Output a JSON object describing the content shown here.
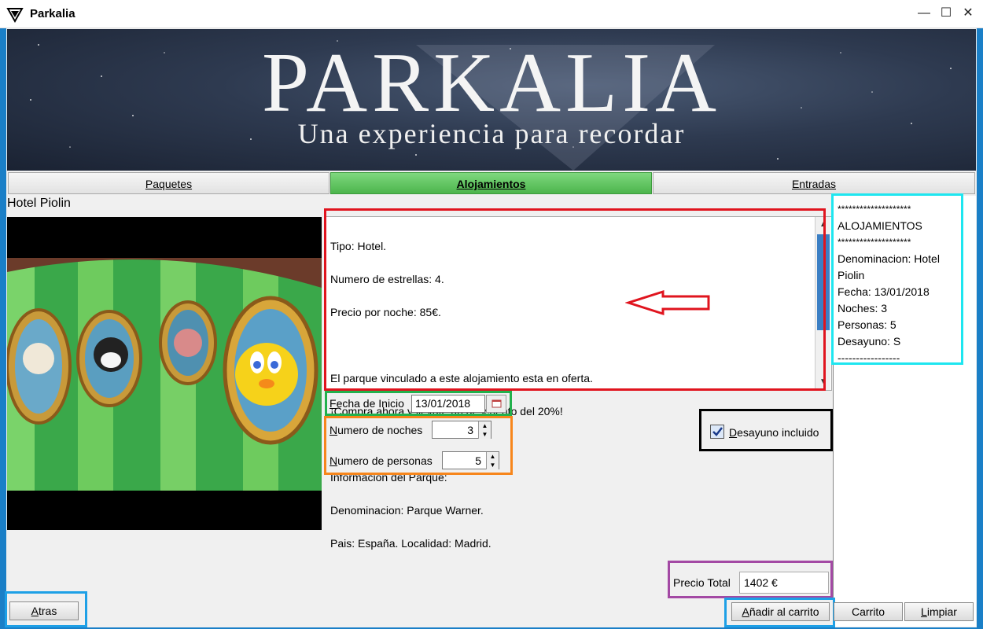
{
  "window": {
    "title": "Parkalia",
    "minimize": "—",
    "maximize": "☐",
    "close": "✕"
  },
  "banner": {
    "title": "PARKALIA",
    "subtitle": "Una experiencia para recordar"
  },
  "tabs": [
    {
      "label": "Paquetes",
      "active": false
    },
    {
      "label": "Alojamientos",
      "active": true
    },
    {
      "label": "Entradas",
      "active": false
    }
  ],
  "hotel": {
    "name": "Hotel Piolin"
  },
  "description": {
    "lines": [
      "Tipo: Hotel.",
      "Numero de estrellas: 4.",
      "Precio por noche: 85€.",
      "",
      "El parque vinculado a este alojamiento esta en oferta.",
      "¡Compra ahora y llevate un descuento del 20%!",
      "",
      "Informacion del Parque:",
      "Denominacion: Parque Warner.",
      "Pais: España. Localidad: Madrid."
    ]
  },
  "form": {
    "fecha_label_key": "F",
    "fecha_label_rest": "echa de Inicio",
    "fecha_value": "13/01/2018",
    "noches_label_key": "N",
    "noches_label_rest": "umero de noches",
    "noches_value": "3",
    "personas_label_key": "N",
    "personas_label_rest": "umero de personas",
    "personas_value": "5",
    "desayuno_label_key": "D",
    "desayuno_label_rest": "esayuno incluido",
    "desayuno_checked": true,
    "precio_label": "Precio Total",
    "precio_value": "1402 €"
  },
  "summary": {
    "lines": [
      "********************",
      "ALOJAMIENTOS",
      "********************",
      "Denominacion: Hotel",
      "Piolin",
      "Fecha: 13/01/2018",
      "Noches: 3",
      "Personas: 5",
      "Desayuno: S",
      "-----------------"
    ]
  },
  "buttons": {
    "atras_key": "A",
    "atras_rest": "tras",
    "anadir_key": "A",
    "anadir_rest": "ñadir al carrito",
    "carrito": "Carrito",
    "limpiar_key": "L",
    "limpiar_rest": "impiar"
  },
  "colors": {
    "tab_active": "#4cb54c",
    "highlight_red": "#e0141e",
    "highlight_green": "#22b14c",
    "highlight_orange": "#f7861c",
    "highlight_black": "#000000",
    "highlight_cyan": "#1ee6f0",
    "highlight_purple": "#a349a4",
    "highlight_blue": "#1ea0e6",
    "window_border": "#1a7fc7"
  },
  "icons": {
    "app_logo": "parkalia-logo-icon",
    "calendar": "calendar-icon",
    "checkbox": "checkbox-checked-icon",
    "arrow": "red-arrow-annotation"
  }
}
